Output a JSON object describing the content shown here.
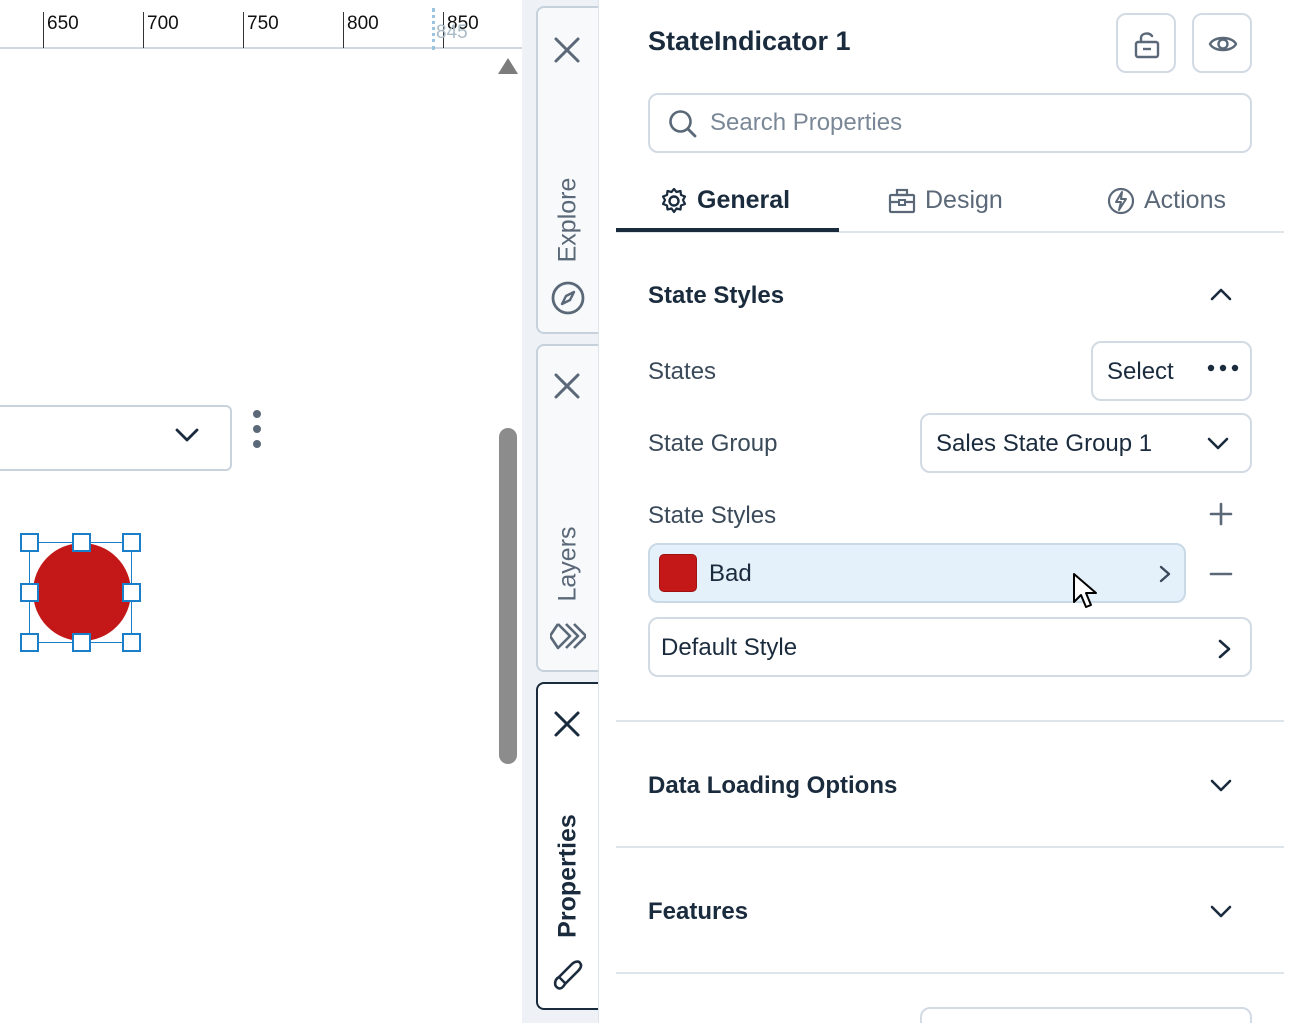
{
  "ruler": {
    "ticks": [
      "650",
      "700",
      "750",
      "800",
      "850"
    ],
    "marker_label": "845"
  },
  "canvas": {
    "selected_element": {
      "fill_color": "#c41818"
    }
  },
  "side_tabs": [
    {
      "label": "Explore",
      "icon": "compass-icon",
      "active": false
    },
    {
      "label": "Layers",
      "icon": "layers-icon",
      "active": false
    },
    {
      "label": "Properties",
      "icon": "paintbrush-icon",
      "active": true
    }
  ],
  "panel": {
    "title": "StateIndicator 1",
    "search_placeholder": "Search Properties",
    "tabs": [
      {
        "label": "General",
        "icon": "gear-icon",
        "active": true
      },
      {
        "label": "Design",
        "icon": "toolbox-icon",
        "active": false
      },
      {
        "label": "Actions",
        "icon": "lightning-icon",
        "active": false
      }
    ],
    "sections": {
      "state_styles": {
        "title": "State Styles",
        "expanded": true,
        "states_label": "States",
        "states_button": "Select",
        "state_group_label": "State Group",
        "state_group_value": "Sales State Group 1",
        "state_styles_label": "State Styles",
        "styles": [
          {
            "name": "Bad",
            "color": "#c41818",
            "selected": true
          }
        ],
        "default_style": "Default Style"
      },
      "data_loading": {
        "title": "Data Loading Options",
        "expanded": false
      },
      "features": {
        "title": "Features",
        "expanded": false
      }
    }
  },
  "colors": {
    "accent": "#1a2b3d",
    "selection": "#1a7fc8",
    "selected_row_bg": "#e4f1fa"
  }
}
